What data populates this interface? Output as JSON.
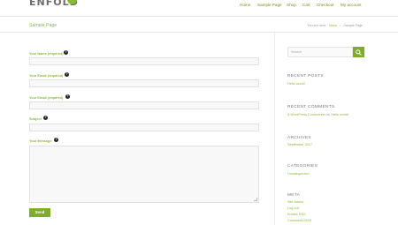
{
  "header": {
    "logo": "ENFOLD",
    "nav": [
      "Home",
      "Sample Page",
      "Shop",
      "Cart",
      "Checkout",
      "My account"
    ]
  },
  "titlebar": {
    "title": "Sample Page",
    "breadcrumb": {
      "prefix": "You are here:",
      "home": "Home",
      "sep": "/",
      "current": "Sample Page"
    }
  },
  "form": {
    "fields": [
      {
        "label": "Your Name (required)"
      },
      {
        "label": "Your Email (required)"
      },
      {
        "label": "Your Email (required)"
      },
      {
        "label": "Subject"
      },
      {
        "label": "Your Message"
      }
    ],
    "help_glyph": "?",
    "submit_label": "Send"
  },
  "sidebar": {
    "search": {
      "placeholder": "Search",
      "icon": "search-icon"
    },
    "recent_posts": {
      "title": "RECENT POSTS",
      "items": [
        "Hello world!"
      ]
    },
    "recent_comments": {
      "title": "RECENT COMMENTS",
      "items": [
        {
          "author": "A WordPress Commenter",
          "on": "on",
          "post": "Hello world!"
        }
      ]
    },
    "archives": {
      "title": "ARCHIVES",
      "items": [
        "September 2017"
      ]
    },
    "categories": {
      "title": "CATEGORIES",
      "items": [
        "Uncategorized"
      ]
    },
    "meta": {
      "title": "META",
      "items": [
        "Site Admin",
        "Log out",
        "Entries RSS",
        "Comments RSS"
      ]
    }
  },
  "colors": {
    "accent": "#8bba34",
    "button": "#7fad2b"
  }
}
